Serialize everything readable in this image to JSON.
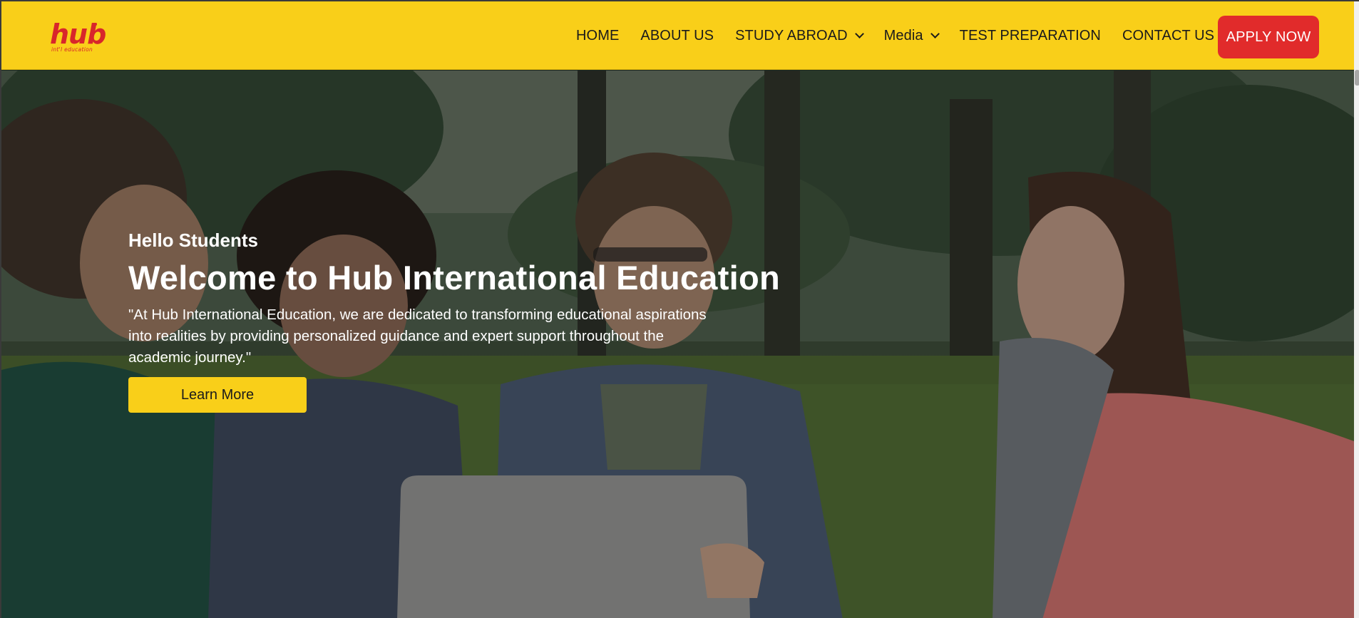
{
  "brand": {
    "logo_word": "hub",
    "logo_sub": "int'l education",
    "brand_color": "#d8262b",
    "nav_color": "#f9cf19"
  },
  "nav": {
    "items": [
      {
        "label": "HOME",
        "dropdown": false
      },
      {
        "label": "ABOUT US",
        "dropdown": false
      },
      {
        "label": "STUDY ABROAD",
        "dropdown": true
      },
      {
        "label": "Media",
        "dropdown": true
      },
      {
        "label": "TEST PREPARATION",
        "dropdown": false
      },
      {
        "label": "CONTACT US",
        "dropdown": false
      }
    ],
    "apply_label": "APPLY NOW",
    "apply_color": "#e12b2b"
  },
  "hero": {
    "eyebrow": "Hello Students",
    "title": "Welcome to Hub International Education",
    "text": "\"At Hub International Education, we are dedicated to transforming educational aspirations into realities by providing personalized guidance and expert support throughout the academic journey.\"",
    "cta_label": "Learn More",
    "background_image": "students-in-park-with-laptop"
  }
}
